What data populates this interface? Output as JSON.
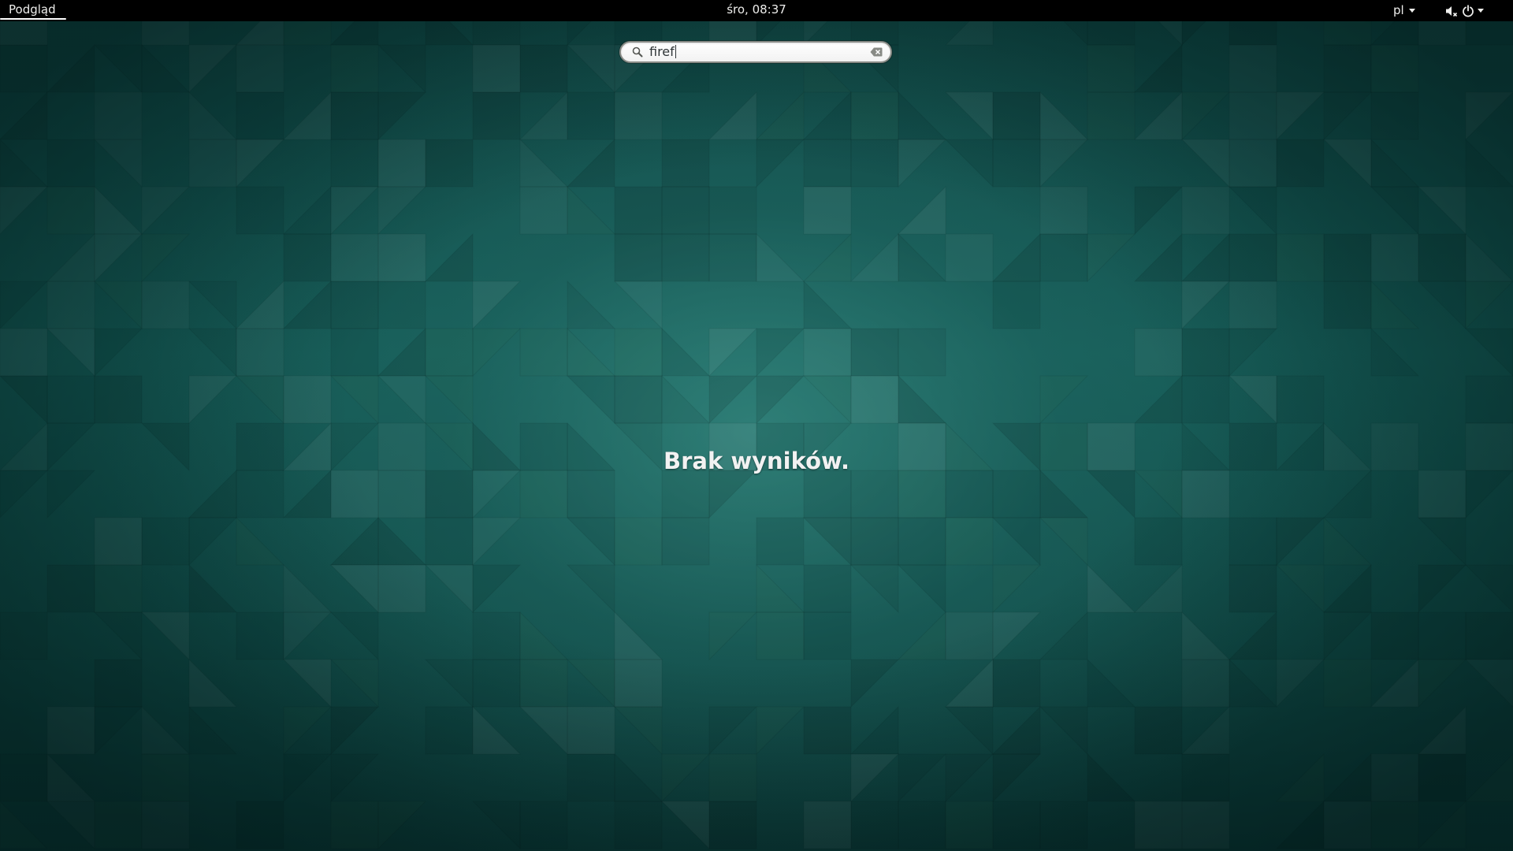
{
  "topbar": {
    "activities_label": "Podgląd",
    "clock": "śro, 08:37",
    "language": "pl",
    "volume_icon": "volume-muted-icon",
    "power_icon": "power-icon"
  },
  "search": {
    "value": "firef",
    "search_icon": "search-icon",
    "clear_icon": "clear-icon"
  },
  "results": {
    "message": "Brak wyników."
  },
  "colors": {
    "topbar": "#000000",
    "wallpaper": "#145a55"
  }
}
